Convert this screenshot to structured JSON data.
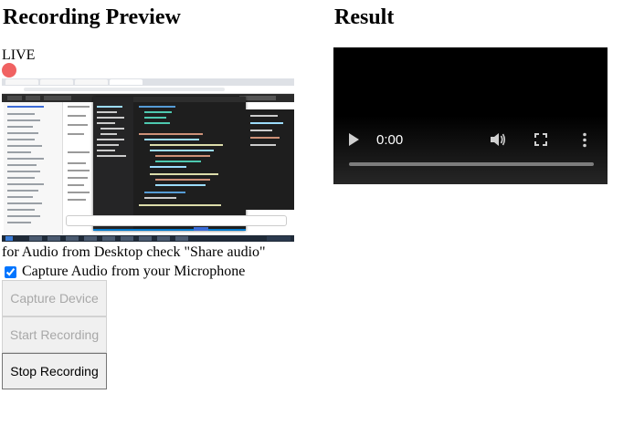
{
  "left": {
    "heading": "Recording Preview",
    "live_label": "LIVE",
    "hint": "for Audio from Desktop check \"Share audio\"",
    "mic_label": "Capture Audio from your Microphone",
    "mic_checked": true
  },
  "right": {
    "heading": "Result",
    "video": {
      "time": "0:00",
      "progress": 0
    }
  },
  "buttons": {
    "capture": "Capture Device",
    "start": "Start Recording",
    "stop": "Stop Recording"
  },
  "colors": {
    "live_dot": "#f06262",
    "checkbox": "#0075ff"
  }
}
